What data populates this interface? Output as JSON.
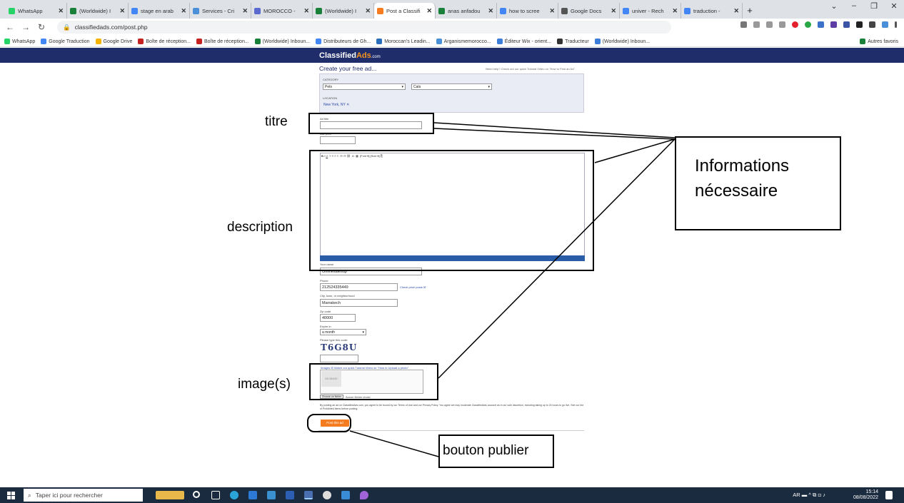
{
  "tabs": [
    "WhatsApp",
    "(Worldwide) I",
    "stage en arab",
    "Services - Cri",
    "MOROCCO -",
    "(Worldwide) I",
    "Post a Classifi",
    "anas anfadou",
    "how to scree",
    "Google Docs",
    "univer - Rech",
    "traduction -"
  ],
  "tab_colors": [
    "#25d366",
    "#188038",
    "#4285f4",
    "#4a90d9",
    "#5a6acf",
    "#188038",
    "#f57c1e",
    "#188038",
    "#4285f4",
    "#555555",
    "#4285f4",
    "#4285f4"
  ],
  "url": "classifiedads.com/post.php",
  "bookmarks": [
    "WhatsApp",
    "Google Traduction",
    "Google Drive",
    "Boîte de réception...",
    "Boîte de réception...",
    "(Worldwide) Inboun...",
    "Distributeurs de Gh...",
    "Moroccan's Leadin...",
    "Arganismemorocco...",
    "Éditeur Wix - orient...",
    "Traducteur",
    "(Worldwide) Inboun...",
    "Autres favoris"
  ],
  "site": {
    "logo_a": "Classified",
    "logo_b": "Ads",
    "logo_c": ".com",
    "create_title": "Create your free ad...",
    "help_text": "Need help? Check out our quick Tutorial Video on \"How to Post an Ad\"",
    "category_label": "CATEGORY",
    "category_value": "Pets",
    "subcategory_value": "Cats",
    "location_label": "LOCATION",
    "location_value": "New York, NY ✕",
    "ad_title_label": "Ad title",
    "price_label": "Ask price",
    "name_label": "Your name",
    "name_value": "Onlinesalesup",
    "phone_label": "Phone",
    "phone_value": "212524335449",
    "phone_hint": "Check price posts ☒",
    "city_label": "City, town, or neighborhood",
    "city_value": "Marrakech",
    "zip_label": "Zip code",
    "zip_value": "40000",
    "expire_label": "Expire in",
    "expire_value": "a month",
    "captcha_label": "Please type this code:",
    "captcha_value": "T6G8U",
    "images_label": "Images ☒ Watch our quick Tutorial Video on \"How to Upload a photo\"",
    "no_image": "NO IMAGE",
    "file_button": "Choose un fichier",
    "file_status": "Aucun fichier choisi",
    "terms": "By posting an ad on ClassifiedAds.com, you agree to be bound by our Terms of Use and our Privacy Policy. You agree we may moderate ClassifiedAds account as in our sole discretion, including taking up to 24 hours to go live. See our list of Prohibited Items before posting.",
    "post_button": "Post this ad"
  },
  "annotations": {
    "titre": "titre",
    "description": "description",
    "images": "image(s)",
    "info_line1": "Informations",
    "info_line2": "nécessaire",
    "publish": "bouton publier"
  },
  "taskbar": {
    "search_placeholder": "Taper ici pour rechercher",
    "lang": "AR",
    "time": "15:14",
    "date": "08/08/2022"
  }
}
